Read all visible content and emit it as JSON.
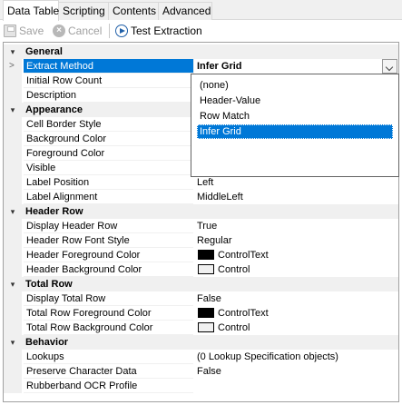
{
  "tabs": [
    {
      "label": "Data Table",
      "active": true
    },
    {
      "label": "Scripting",
      "active": false
    },
    {
      "label": "Contents",
      "active": false
    },
    {
      "label": "Advanced",
      "active": false
    }
  ],
  "toolbar": {
    "save_label": "Save",
    "cancel_label": "Cancel",
    "test_label": "Test Extraction"
  },
  "grid": {
    "general": {
      "title": "General",
      "extract_method": {
        "name": "Extract Method",
        "value": "Infer Grid"
      },
      "initial_row_count": {
        "name": "Initial Row Count",
        "value": ""
      },
      "description": {
        "name": "Description",
        "value": ""
      }
    },
    "appearance": {
      "title": "Appearance",
      "cell_border_style": {
        "name": "Cell Border Style",
        "value": ""
      },
      "background_color": {
        "name": "Background Color",
        "value": ""
      },
      "foreground_color": {
        "name": "Foreground Color",
        "value": ""
      },
      "visible": {
        "name": "Visible",
        "value": ""
      },
      "label_position": {
        "name": "Label Position",
        "value": "Left"
      },
      "label_alignment": {
        "name": "Label Alignment",
        "value": "MiddleLeft"
      }
    },
    "header_row": {
      "title": "Header Row",
      "display_header_row": {
        "name": "Display Header Row",
        "value": "True"
      },
      "header_row_font_style": {
        "name": "Header Row Font Style",
        "value": "Regular"
      },
      "header_foreground_color": {
        "name": "Header Foreground Color",
        "value": "ControlText",
        "swatch": "#000000"
      },
      "header_background_color": {
        "name": "Header Background Color",
        "value": "Control",
        "swatch": "#f0f0f0"
      }
    },
    "total_row": {
      "title": "Total Row",
      "display_total_row": {
        "name": "Display Total Row",
        "value": "False"
      },
      "total_row_foreground_color": {
        "name": "Total Row Foreground Color",
        "value": "ControlText",
        "swatch": "#000000"
      },
      "total_row_background_color": {
        "name": "Total Row Background Color",
        "value": "Control",
        "swatch": "#f0f0f0"
      }
    },
    "behavior": {
      "title": "Behavior",
      "lookups": {
        "name": "Lookups",
        "value": "(0 Lookup Specification objects)"
      },
      "preserve_character_data": {
        "name": "Preserve Character Data",
        "value": "False"
      },
      "rubberband_ocr_profile": {
        "name": "Rubberband OCR Profile",
        "value": ""
      }
    }
  },
  "dropdown": {
    "options": [
      "(none)",
      "Header-Value",
      "Row Match",
      "Infer Grid"
    ],
    "selected": "Infer Grid"
  },
  "colors": {
    "selection": "#0078d7",
    "category_background": "#f0f0f0",
    "tab_background": "#f0f0f0"
  }
}
